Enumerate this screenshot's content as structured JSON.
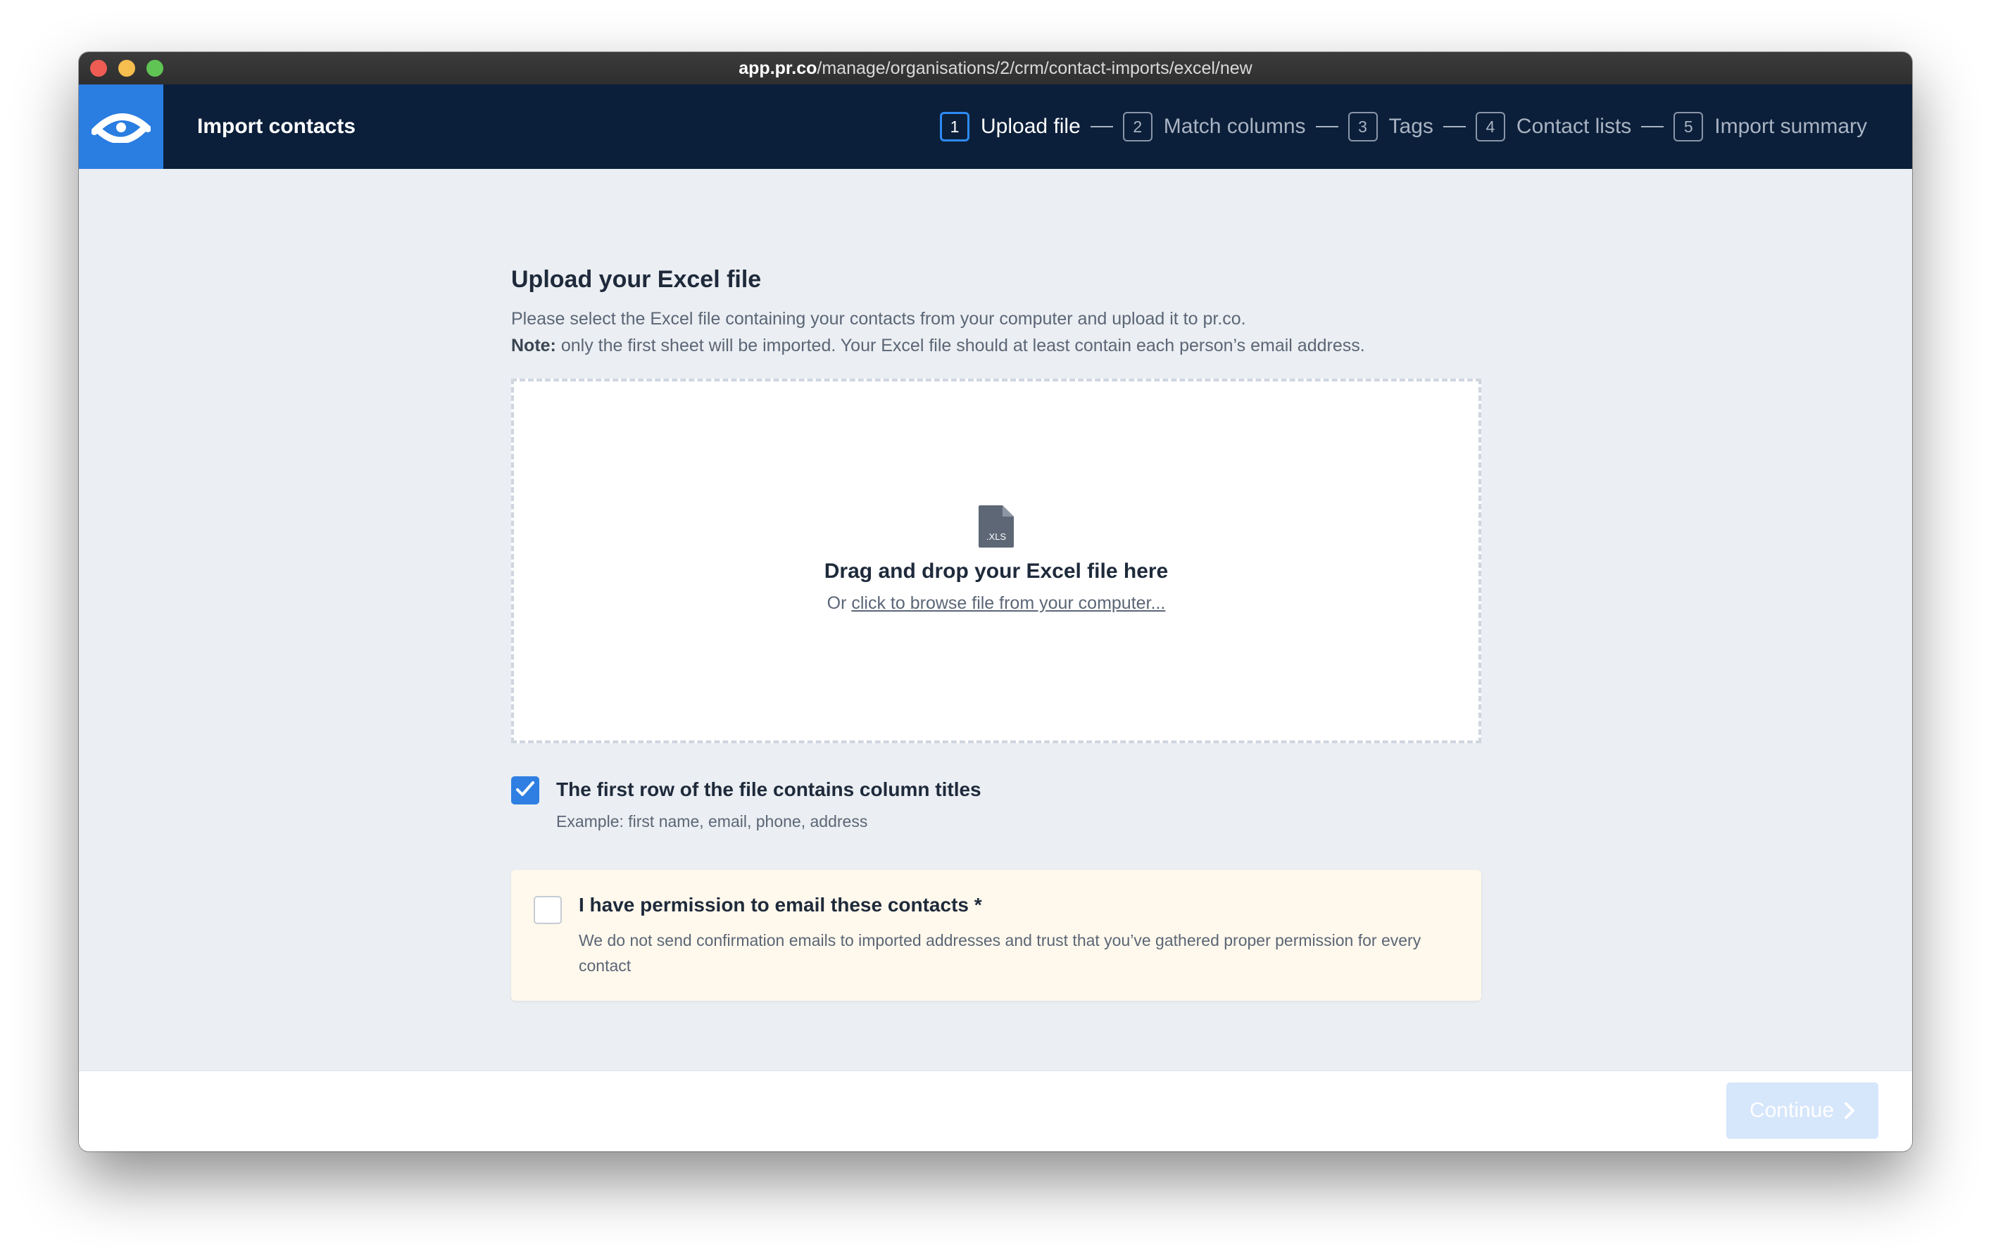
{
  "browser": {
    "url_host": "app.pr.co",
    "url_path": "/manage/organisations/2/crm/contact-imports/excel/new"
  },
  "header": {
    "title": "Import contacts",
    "steps": [
      {
        "number": "1",
        "label": "Upload file",
        "active": true
      },
      {
        "number": "2",
        "label": "Match columns",
        "active": false
      },
      {
        "number": "3",
        "label": "Tags",
        "active": false
      },
      {
        "number": "4",
        "label": "Contact lists",
        "active": false
      },
      {
        "number": "5",
        "label": "Import summary",
        "active": false
      }
    ]
  },
  "main": {
    "heading": "Upload your Excel file",
    "description": "Please select the Excel file containing your contacts from your computer and upload it to pr.co.",
    "note_label": "Note:",
    "note_text": " only the first sheet will be imported. Your Excel file should at least contain each person’s email address.",
    "dropzone": {
      "file_icon_text": ".XLS",
      "title": "Drag and drop your Excel file here",
      "sub_prefix": "Or ",
      "browse_link": "click to browse file from your computer..."
    },
    "first_row_option": {
      "checked": true,
      "label": "The first row of the file contains column titles",
      "hint": "Example: first name, email, phone, address"
    },
    "permission_option": {
      "checked": false,
      "label": "I have permission to email these contacts *",
      "hint": "We do not send confirmation emails to imported addresses and trust that you’ve gathered proper permission for every contact"
    }
  },
  "footer": {
    "continue_label": "Continue"
  },
  "colors": {
    "header_bg": "#0b1f3a",
    "accent": "#2a7de1",
    "page_bg": "#ebeef2",
    "permission_bg": "#fff8ec",
    "continue_disabled": "#d6e6fb"
  },
  "icons": {
    "logo": "pr-co-logo-icon",
    "file": "xls-file-icon",
    "check": "checkmark-icon",
    "chevron": "chevron-right-icon"
  }
}
